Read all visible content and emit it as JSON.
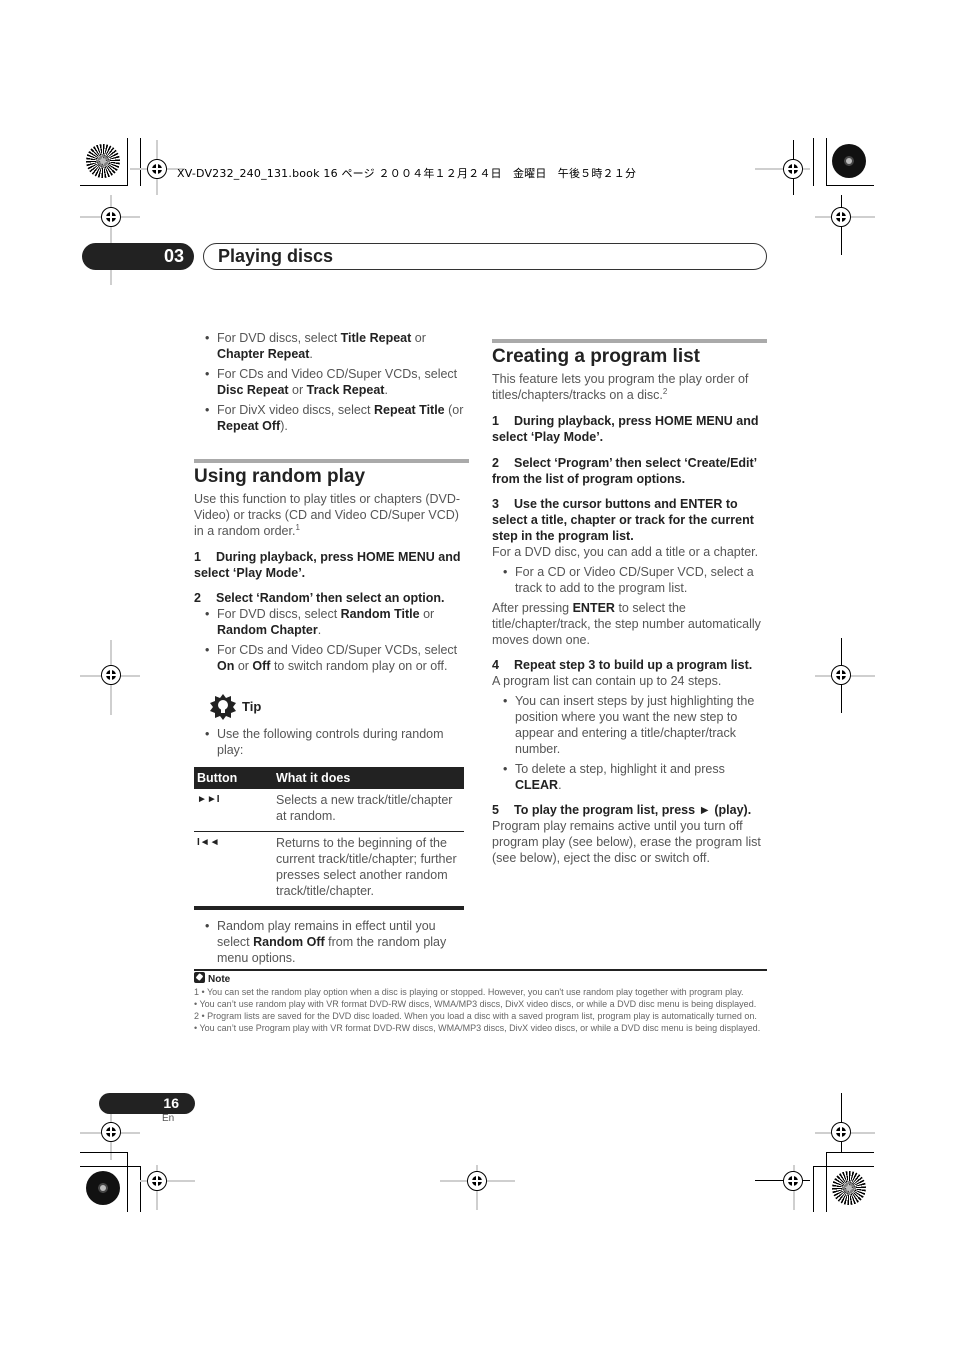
{
  "print_meta": "XV-DV232_240_131.book  16 ページ  ２００４年１２月２４日　金曜日　午後５時２１分",
  "chapter": {
    "number": "03",
    "title": "Playing discs"
  },
  "left_column": {
    "repeat_bullets": [
      {
        "pre": "For DVD discs, select ",
        "b1": "Title Repeat",
        "mid": " or ",
        "b2": "Chapter Repeat",
        "post": "."
      },
      {
        "pre": "For CDs and Video CD/Super VCDs, select ",
        "b1": "Disc Repeat",
        "mid": " or ",
        "b2": "Track Repeat",
        "post": "."
      },
      {
        "pre": "For DivX video discs, select ",
        "b1": "Repeat Title",
        "mid": " (or ",
        "b2": "Repeat Off",
        "post": ")."
      }
    ],
    "random_section": {
      "title": "Using random play",
      "intro": "Use this function to play titles or chapters (DVD-Video) or tracks (CD and Video CD/Super VCD) in a random order.",
      "intro_footnote": "1",
      "step1": {
        "num": "1",
        "text": "During playback, press HOME MENU and select ‘Play Mode’."
      },
      "step2": {
        "num": "2",
        "text": "Select ‘Random’ then select an option."
      },
      "step2_bullets": [
        {
          "pre": "For DVD discs, select ",
          "b1": "Random Title",
          "mid": " or ",
          "b2": "Random Chapter",
          "post": "."
        },
        {
          "pre": "For CDs and Video CD/Super VCDs, select ",
          "b1": "On",
          "mid": " or ",
          "b2": "Off",
          "post": " to switch random play on or off."
        }
      ],
      "tip_label": "Tip",
      "tip_bullet": "Use the following controls during random play:",
      "table": {
        "headers": [
          "Button",
          "What it does"
        ],
        "rows": [
          {
            "button": "►►I",
            "button_icon": "next-track-icon",
            "desc": "Selects a new track/title/chapter at random."
          },
          {
            "button": "I◄◄",
            "button_icon": "previous-track-icon",
            "desc": "Returns to the beginning of the current track/title/chapter; further presses select another random track/title/chapter."
          }
        ]
      },
      "after_table_bullet": {
        "pre": "Random play remains in effect until you select ",
        "b1": "Random Off",
        "post": " from the random play menu options."
      }
    }
  },
  "right_column": {
    "title": "Creating a program list",
    "intro": "This feature lets you program the play order of titles/chapters/tracks on a disc.",
    "intro_footnote": "2",
    "step1": {
      "num": "1",
      "text": "During playback, press HOME MENU and select ‘Play Mode’."
    },
    "step2": {
      "num": "2",
      "text": "Select ‘Program’ then select ‘Create/Edit’ from the list of program options."
    },
    "step3": {
      "num": "3",
      "text": "Use the cursor buttons and ENTER to select a title, chapter or track for the current step in the program list."
    },
    "step3_body": "For a DVD disc, you can add a title or a chapter.",
    "step3_bullet": "For a CD or Video CD/Super VCD, select a track to add to the program list.",
    "step3_after": {
      "pre": "After pressing ",
      "b1": "ENTER",
      "post": " to select the title/chapter/track, the step number automatically moves down one."
    },
    "step4": {
      "num": "4",
      "text": "Repeat step 3 to build up a program list."
    },
    "step4_body": "A program list can contain up to 24 steps.",
    "step4_bullets": [
      {
        "pre": "You can insert steps by just highlighting the position where you want the new step to appear and entering a title/chapter/track number.",
        "b1": "",
        "post": ""
      },
      {
        "pre": "To delete a step, highlight it and press ",
        "b1": "CLEAR",
        "post": "."
      }
    ],
    "step5": {
      "num": "5",
      "text": "To play the program list, press ► (play)."
    },
    "step5_body": "Program play remains active until you turn off program play (see below), erase the program list (see below), eject the disc or switch off."
  },
  "notes": {
    "label": "Note",
    "lines": [
      "1  • You can set the random play option when a disc is playing or stopped. However, you can't use random play together with program play.",
      "   • You can’t use random play with VR format DVD-RW discs, WMA/MP3 discs, DivX video discs, or while a DVD disc menu is being displayed.",
      "2  • Program lists are saved for the DVD disc loaded. When you load a disc with a saved program list, program play is automatically turned on.",
      "   • You can’t use Program play with VR format DVD-RW discs, WMA/MP3 discs, DivX video discs, or while a DVD disc menu is being displayed."
    ]
  },
  "footer": {
    "page_number": "16",
    "language": "En"
  }
}
